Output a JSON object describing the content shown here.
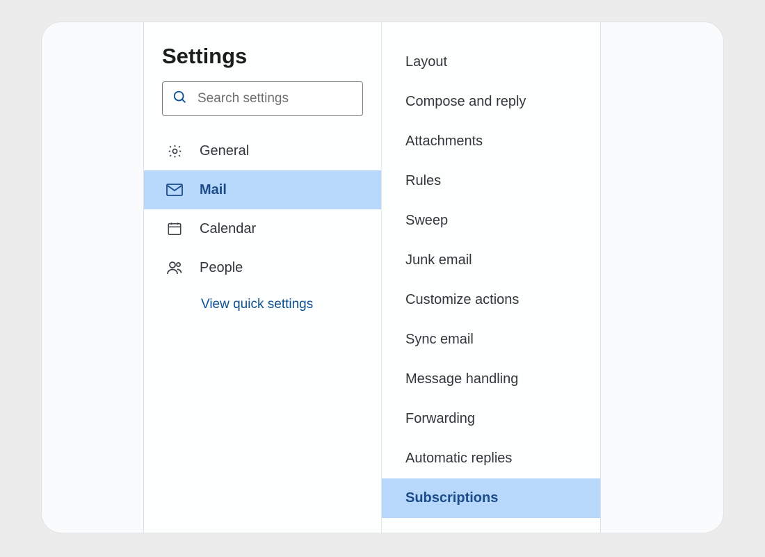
{
  "title": "Settings",
  "search_placeholder": "Search settings",
  "primary_nav": [
    {
      "icon": "gear",
      "label": "General",
      "selected": false
    },
    {
      "icon": "mail",
      "label": "Mail",
      "selected": true
    },
    {
      "icon": "calendar",
      "label": "Calendar",
      "selected": false
    },
    {
      "icon": "people",
      "label": "People",
      "selected": false
    }
  ],
  "quick_settings_label": "View quick settings",
  "secondary_nav": [
    {
      "label": "Layout",
      "selected": false
    },
    {
      "label": "Compose and reply",
      "selected": false
    },
    {
      "label": "Attachments",
      "selected": false
    },
    {
      "label": "Rules",
      "selected": false
    },
    {
      "label": "Sweep",
      "selected": false
    },
    {
      "label": "Junk email",
      "selected": false
    },
    {
      "label": "Customize actions",
      "selected": false
    },
    {
      "label": "Sync email",
      "selected": false
    },
    {
      "label": "Message handling",
      "selected": false
    },
    {
      "label": "Forwarding",
      "selected": false
    },
    {
      "label": "Automatic replies",
      "selected": false
    },
    {
      "label": "Subscriptions",
      "selected": true
    }
  ],
  "colors": {
    "selection_bg": "#b7d8fb",
    "selection_fg": "#1b4b88",
    "link": "#0a5092"
  }
}
